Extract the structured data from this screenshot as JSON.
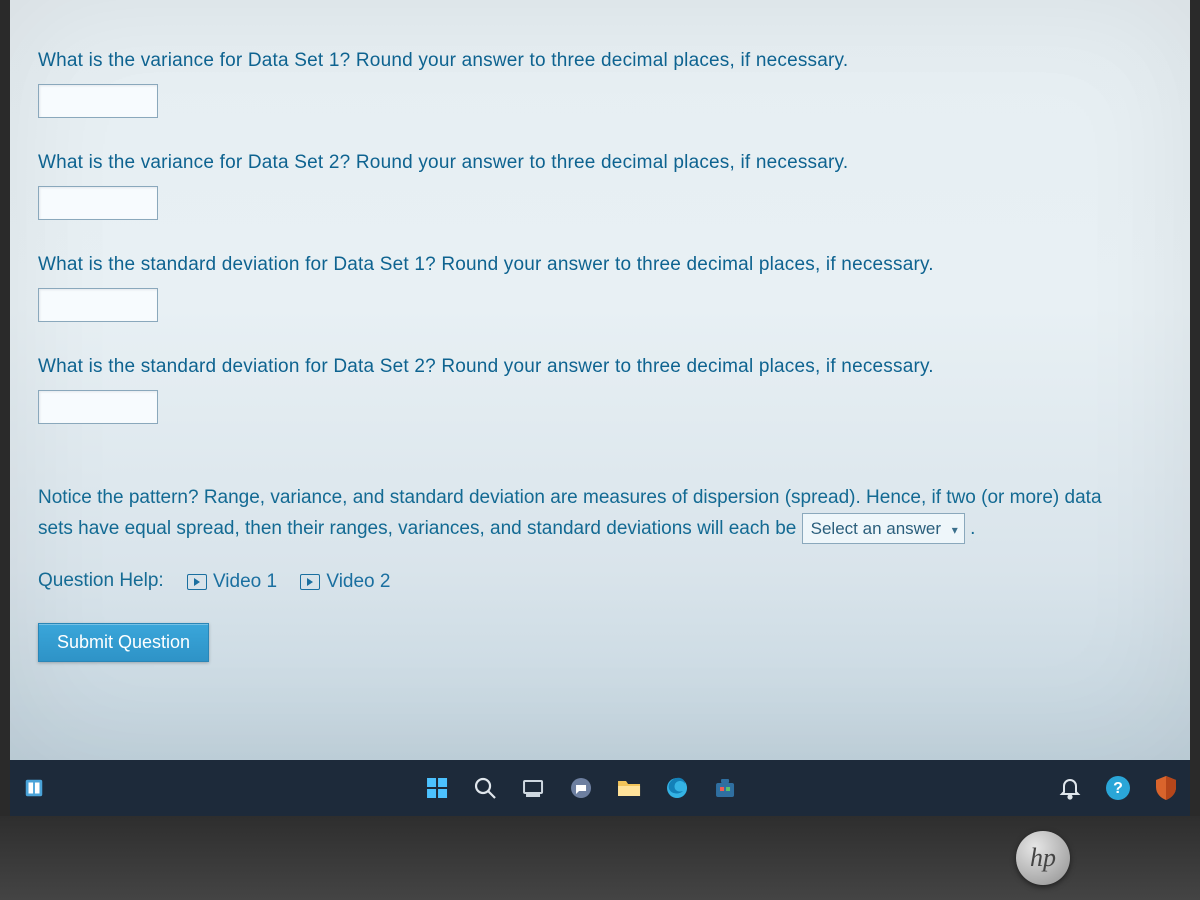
{
  "questions": {
    "q1": "What is the variance for Data Set 1? Round your answer to three decimal places, if necessary.",
    "q2": "What is the variance for Data Set 2? Round your answer to three decimal places, if necessary.",
    "q3": "What is the standard deviation for Data Set 1? Round your answer to three decimal places, if necessary.",
    "q4": "What is the standard deviation for Data Set 2? Round your answer to three decimal places, if necessary."
  },
  "paragraph": {
    "part1": "Notice the pattern? Range, variance, and standard deviation are measures of dispersion (spread). Hence, if two (or more) data sets have equal spread, then their ranges, variances, and standard deviations will each be",
    "select_placeholder": "Select an answer",
    "part2": "."
  },
  "help": {
    "label": "Question Help:",
    "video1": "Video 1",
    "video2": "Video 2"
  },
  "submit_label": "Submit Question",
  "logo_text": "hp"
}
